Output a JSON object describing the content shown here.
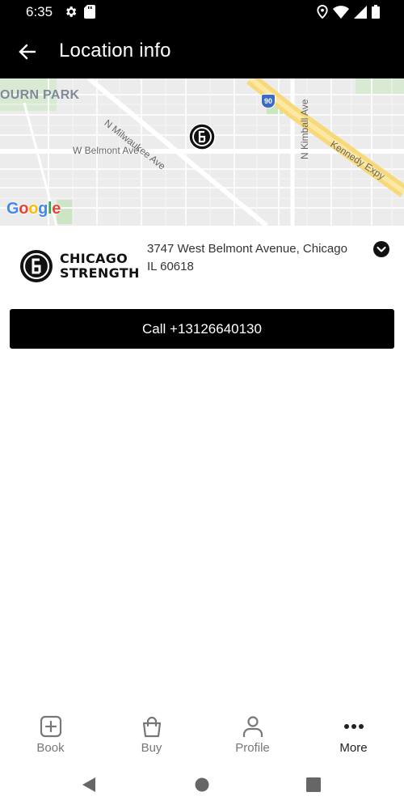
{
  "status_bar": {
    "time": "6:35",
    "left_icons": [
      "gear-icon",
      "sd-card-icon"
    ],
    "right_icons": [
      "location-icon",
      "wifi-icon",
      "signal-icon",
      "battery-icon"
    ]
  },
  "app_bar": {
    "title": "Location info",
    "back_icon": "arrow-left-icon"
  },
  "map": {
    "labels": {
      "park": "OURN PARK",
      "milwaukee": "N Milwaukee Ave",
      "belmont": "W Belmont Ave",
      "kimball": "N Kimball Ave",
      "kennedy": "Kennedy Expy",
      "interstate": "90"
    },
    "google": [
      "G",
      "o",
      "o",
      "g",
      "l",
      "e"
    ]
  },
  "location": {
    "brand_line1": "CHICAGO",
    "brand_line2": "STRENGTH",
    "address_line1": "3747 West Belmont Avenue, Chicago",
    "address_line2": "IL 60618"
  },
  "call_button": {
    "label": "Call +13126640130"
  },
  "bottom_nav": {
    "items": [
      {
        "label": "Book",
        "icon": "plus-square-icon"
      },
      {
        "label": "Buy",
        "icon": "shopping-bag-icon"
      },
      {
        "label": "Profile",
        "icon": "person-icon"
      },
      {
        "label": "More",
        "icon": "more-dots-icon"
      }
    ]
  },
  "colors": {
    "primary": "#000000",
    "background": "#ffffff",
    "map_background": "#ececec",
    "highway": "#f7d97a"
  }
}
